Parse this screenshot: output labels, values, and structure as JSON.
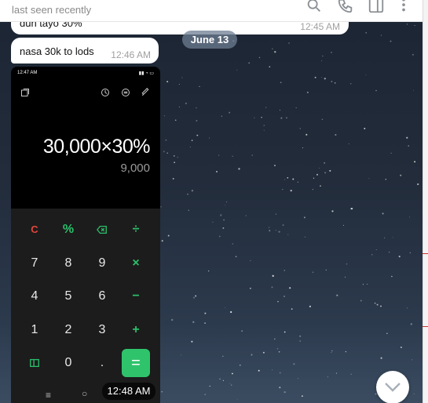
{
  "header": {
    "status": "last seen recently",
    "icons": [
      "search-icon",
      "phone-icon",
      "sidebar-toggle-icon",
      "more-vert-icon"
    ]
  },
  "messages": [
    {
      "text": "dun tayo 30%",
      "time": "12:45 AM"
    },
    {
      "text": "nasa 30k to lods",
      "time": "12:46 AM"
    }
  ],
  "date_separator": "June 13",
  "screenshot": {
    "status_time": "12:47 AM",
    "expression": "30,000×30%",
    "result": "9,000",
    "keys": [
      {
        "label": "C",
        "style": "red"
      },
      {
        "label": "%",
        "style": "green"
      },
      {
        "label": "",
        "icon": "backspace-icon",
        "style": "green"
      },
      {
        "label": "÷",
        "style": "green"
      },
      {
        "label": "7"
      },
      {
        "label": "8"
      },
      {
        "label": "9"
      },
      {
        "label": "×",
        "style": "green"
      },
      {
        "label": "4"
      },
      {
        "label": "5"
      },
      {
        "label": "6"
      },
      {
        "label": "−",
        "style": "green"
      },
      {
        "label": "1"
      },
      {
        "label": "2"
      },
      {
        "label": "3"
      },
      {
        "label": "+",
        "style": "green"
      },
      {
        "label": "",
        "icon": "mode-switch-icon",
        "style": "green"
      },
      {
        "label": "0"
      },
      {
        "label": "."
      },
      {
        "label": "=",
        "style": "eq"
      }
    ],
    "navbar": [
      "≡",
      "○"
    ],
    "time_overlay": "12:48 AM"
  },
  "colors": {
    "accent_green": "#2fc46c",
    "clear_red": "#e2463b"
  }
}
